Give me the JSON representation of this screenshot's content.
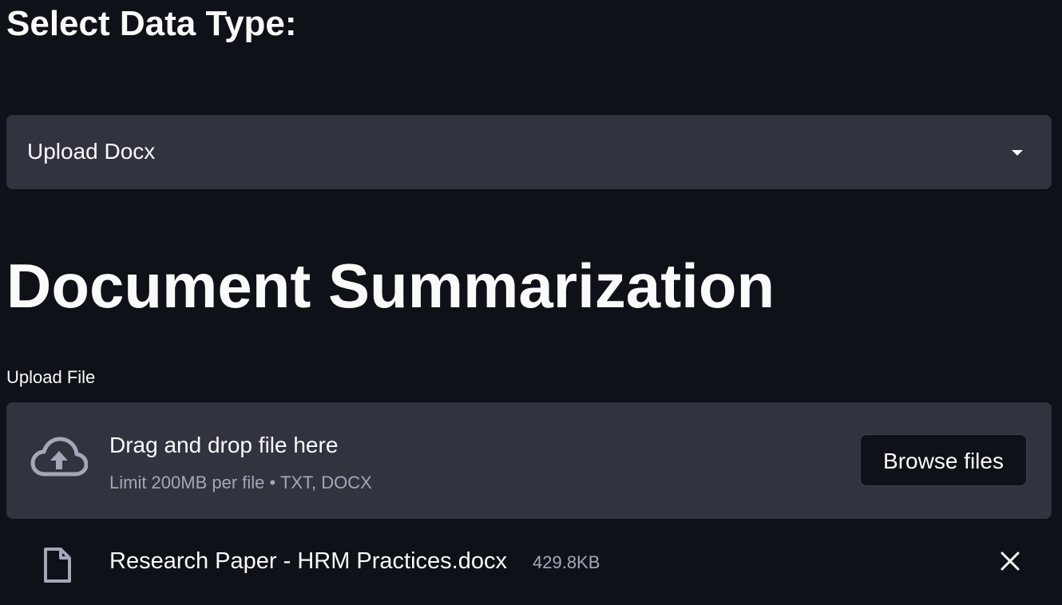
{
  "data_type_section": {
    "title": "Select Data Type:",
    "select": {
      "value": "Upload Docx",
      "caret_icon": "caret-down-icon"
    }
  },
  "summarization": {
    "title": "Document Summarization",
    "upload": {
      "label": "Upload File",
      "dropzone": {
        "icon": "cloud-upload-icon",
        "text": "Drag and drop file here",
        "limit": "Limit 200MB per file • TXT, DOCX",
        "browse_label": "Browse files"
      },
      "files": [
        {
          "icon": "file-icon",
          "name": "Research Paper - HRM Practices.docx",
          "size": "429.8KB",
          "remove_icon": "close-icon"
        }
      ]
    }
  },
  "colors": {
    "background": "#0e1117",
    "panel": "#31333f",
    "text": "#fafafa",
    "muted_text": "#a3a8b8"
  }
}
